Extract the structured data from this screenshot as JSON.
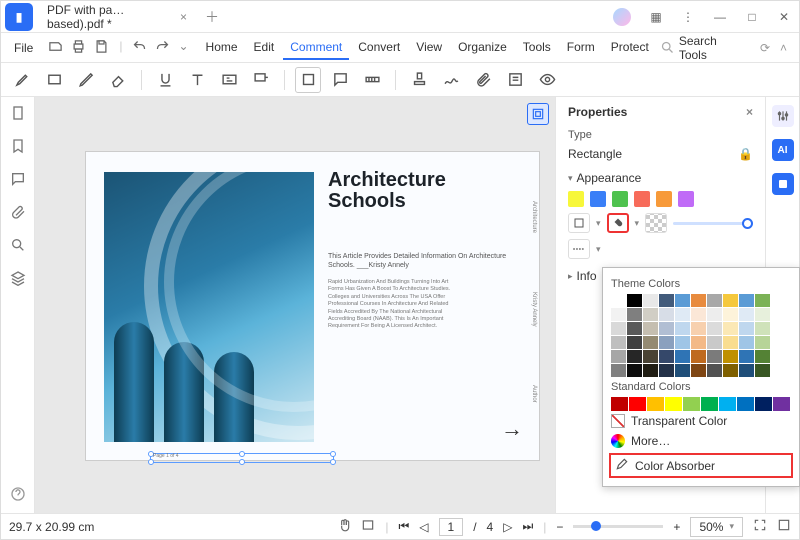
{
  "titlebar": {
    "tab_name": "PDF with pa…based).pdf *"
  },
  "menubar": {
    "file": "File",
    "items": [
      "Home",
      "Edit",
      "Comment",
      "Convert",
      "View",
      "Organize",
      "Tools",
      "Form",
      "Protect"
    ],
    "active": "Comment",
    "search_placeholder": "Search Tools"
  },
  "document": {
    "title1": "Architecture",
    "title2": "Schools",
    "sub": "This Article Provides Detailed Information On Architecture Schools. ___Kristy Annely",
    "body": "Rapid Urbanization And Buildings Turning Into Art Forms Has Given A Boost To Architecture Studies. Colleges and Universities Across The USA Offer Professional Courses In Architecture And Related Fields Accredited By The National Architectural Accrediting Board (NAAB). This Is An Important Requirement For Being A Licensed Architect.",
    "side": [
      "Architecture",
      "Kristy Annely",
      "Author"
    ],
    "pagelabel": "Page 1 of 4"
  },
  "panel": {
    "title": "Properties",
    "type_label": "Type",
    "type_value": "Rectangle",
    "appearance": "Appearance",
    "info": "Info",
    "swatches": [
      "#f7f73a",
      "#3a7ff7",
      "#4fc24f",
      "#f76b5a",
      "#f79a3a",
      "#c06bf7"
    ]
  },
  "popup": {
    "theme": "Theme Colors",
    "standard": "Standard Colors",
    "transparent": "Transparent Color",
    "more": "More…",
    "absorber": "Color Absorber",
    "theme_rows": [
      [
        "#ffffff",
        "#000000",
        "#e8e8e8",
        "#425b7b",
        "#5a9bd5",
        "#e88b3e",
        "#a8a8a8",
        "#f5c83d",
        "#5a9bd5",
        "#7bb256"
      ],
      [
        "#f2f2f2",
        "#7f7f7f",
        "#d1cec5",
        "#d7dde7",
        "#dfeaf5",
        "#fbe7d7",
        "#ededed",
        "#fdf3da",
        "#dfeaf5",
        "#e7f0dc"
      ],
      [
        "#d9d9d9",
        "#595959",
        "#c5beb0",
        "#b1bed3",
        "#bfd7ee",
        "#f7d0ae",
        "#dbdbdb",
        "#fbe8b5",
        "#bfd7ee",
        "#cfe2ba"
      ],
      [
        "#bfbfbf",
        "#404040",
        "#948a72",
        "#8aa0be",
        "#9fc5e6",
        "#f3b987",
        "#c9c9c9",
        "#f9dd90",
        "#9fc5e6",
        "#b7d498"
      ],
      [
        "#a6a6a6",
        "#262626",
        "#4a4334",
        "#35486a",
        "#2f74b5",
        "#bf6a1f",
        "#7b7b7b",
        "#bf9000",
        "#2f74b5",
        "#548235"
      ],
      [
        "#808080",
        "#0d0d0d",
        "#201d13",
        "#233148",
        "#1f4e79",
        "#7f4613",
        "#525252",
        "#7f6000",
        "#1f4e79",
        "#385723"
      ]
    ],
    "standard_row": [
      "#c00000",
      "#ff0000",
      "#ffc000",
      "#ffff00",
      "#92d050",
      "#00b050",
      "#00b0f0",
      "#0070c0",
      "#002060",
      "#7030a0"
    ]
  },
  "statusbar": {
    "dims": "29.7 x 20.99 cm",
    "page_current": "1",
    "page_total": "4",
    "zoom": "50%"
  }
}
